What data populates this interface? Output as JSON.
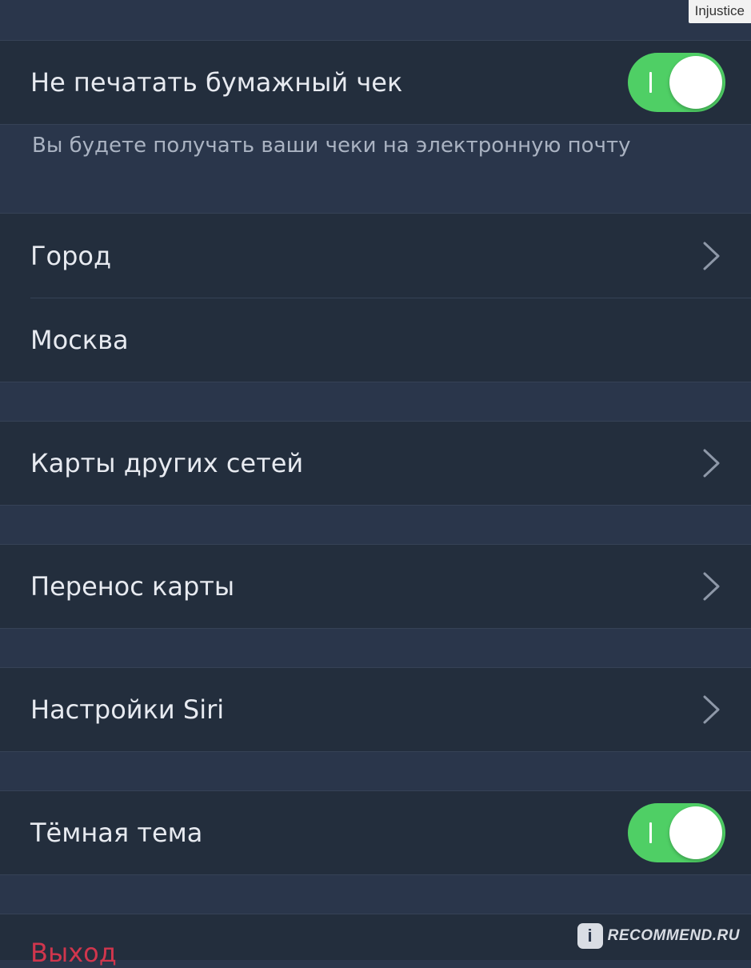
{
  "watermarks": {
    "top_user": "Injustice",
    "bottom_site": "RECOMMEND.RU",
    "bottom_badge": "i"
  },
  "settings": {
    "paper_receipt": {
      "label": "Не печатать бумажный чек",
      "enabled": true,
      "hint": "Вы будете получать ваши чеки на электронную почту"
    },
    "city": {
      "label": "Город",
      "value": "Москва"
    },
    "other_cards": {
      "label": "Карты других сетей"
    },
    "card_transfer": {
      "label": "Перенос карты"
    },
    "siri": {
      "label": "Настройки Siri"
    },
    "dark_theme": {
      "label": "Тёмная тема",
      "enabled": true
    },
    "logout": {
      "label": "Выход"
    }
  },
  "colors": {
    "group_background": "#2a364b",
    "row_background": "#232e3d",
    "toggle_on": "#4fcf65",
    "logout_red": "#d0364d",
    "chevron": "#8e98a8"
  },
  "icons": {
    "chevron": "chevron-right-icon"
  }
}
